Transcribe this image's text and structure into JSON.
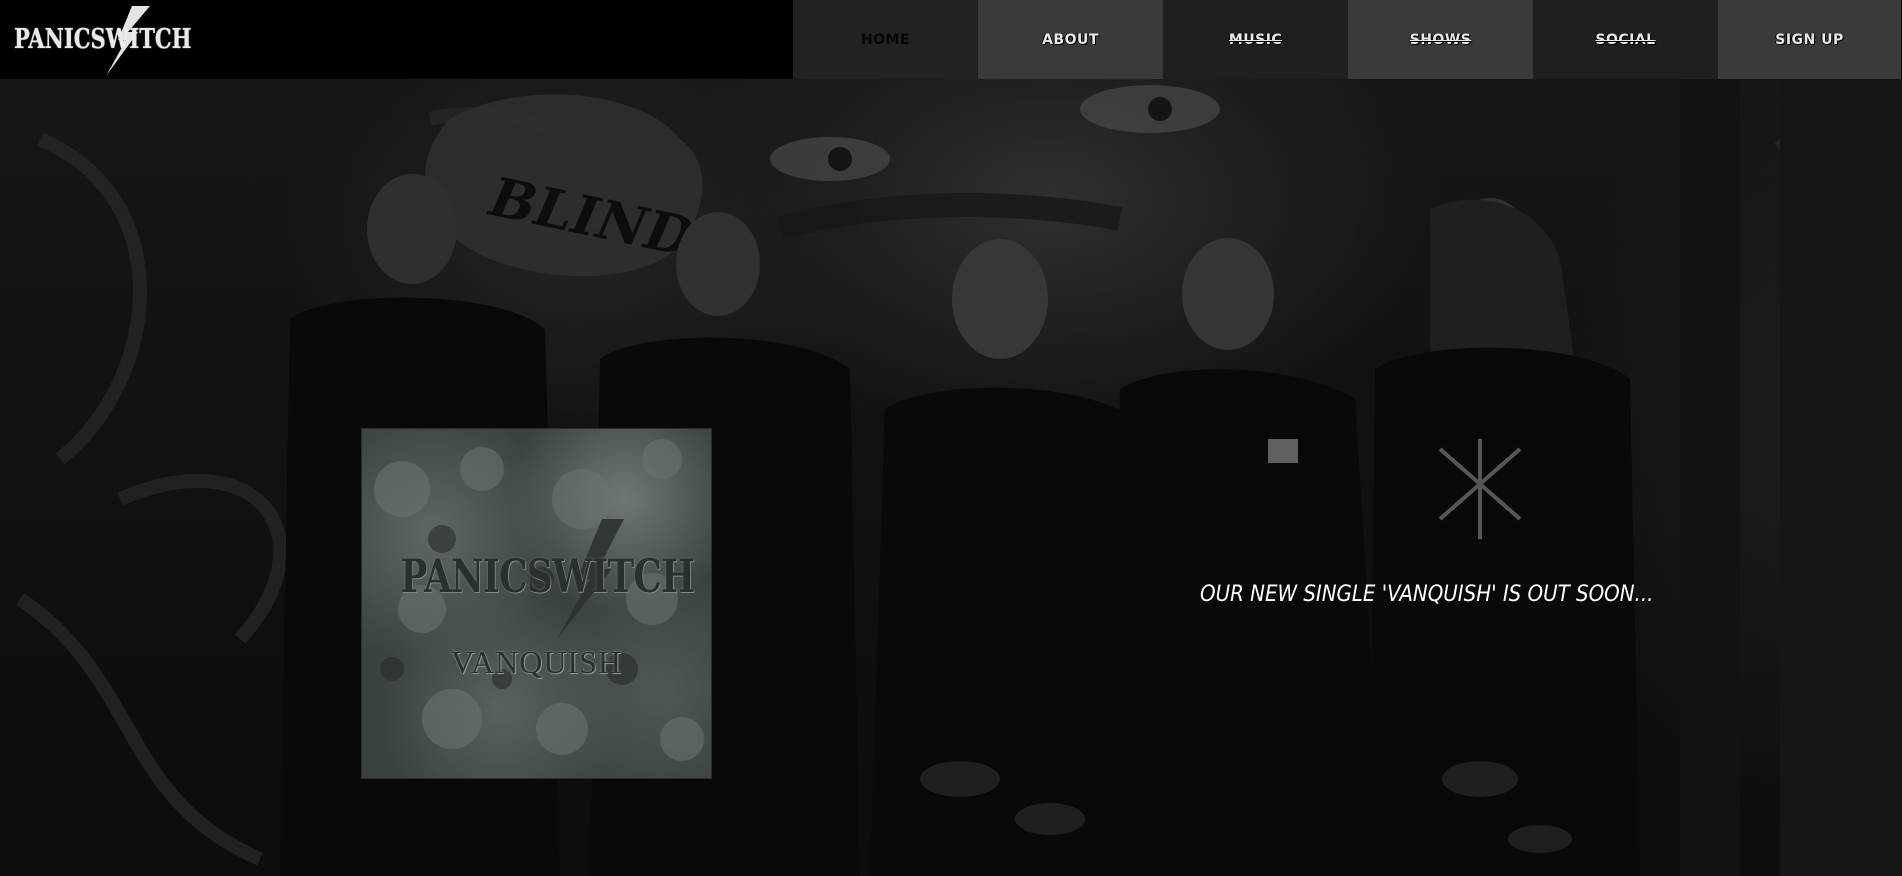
{
  "header": {
    "logo_text": "PANICSWITCH"
  },
  "nav": {
    "items": [
      {
        "label": "HOME"
      },
      {
        "label": "ABOUT"
      },
      {
        "label": "MUSIC"
      },
      {
        "label": "SHOWS"
      },
      {
        "label": "SOCIAL"
      },
      {
        "label": "SIGN UP"
      }
    ],
    "active": "HOME"
  },
  "hero": {
    "album": {
      "band": "PANICSWITCH",
      "title": "VANQUISH"
    },
    "tagline": "OUR NEW SINGLE 'VANQUISH' IS OUT SOON..."
  },
  "colors": {
    "header_bg": "#000000",
    "nav_dark": "#1f1f1f",
    "nav_mid": "#3a3a3a",
    "text": "#ffffff"
  }
}
